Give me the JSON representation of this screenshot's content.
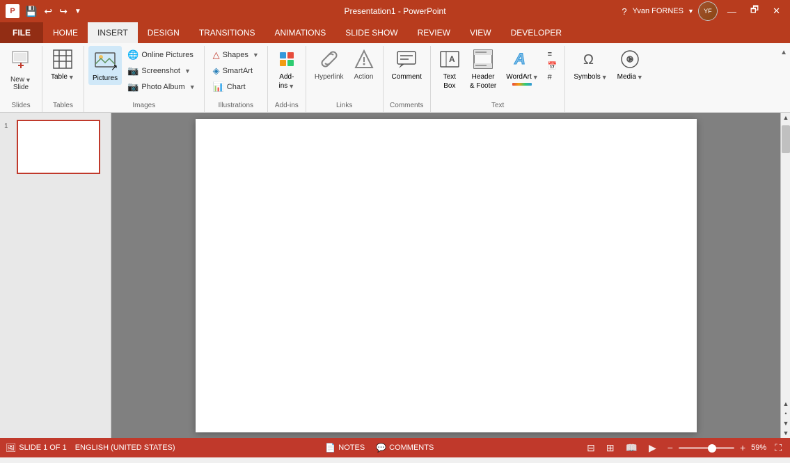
{
  "titleBar": {
    "appName": "Presentation1 - PowerPoint",
    "helpIcon": "?",
    "restoreIcon": "🗗",
    "minimizeIcon": "—",
    "maximizeIcon": "□",
    "closeIcon": "✕",
    "quickAccess": [
      "💾",
      "↩",
      "↪"
    ],
    "user": "Yvan FORNES"
  },
  "menuBar": {
    "tabs": [
      "FILE",
      "HOME",
      "INSERT",
      "DESIGN",
      "TRANSITIONS",
      "ANIMATIONS",
      "SLIDE SHOW",
      "REVIEW",
      "VIEW",
      "DEVELOPER"
    ],
    "activeTab": "INSERT"
  },
  "ribbon": {
    "groups": [
      {
        "label": "Slides",
        "buttons": [
          {
            "id": "new-slide",
            "icon": "🖼",
            "label": "New\nSlide",
            "hasArrow": true
          }
        ]
      },
      {
        "label": "Tables",
        "buttons": [
          {
            "id": "table",
            "icon": "⊞",
            "label": "Table",
            "hasArrow": true
          }
        ]
      },
      {
        "label": "Images",
        "buttons": [
          {
            "id": "pictures",
            "icon": "🖼",
            "label": "Pictures",
            "active": true
          },
          {
            "id": "online-pictures",
            "icon": "🌐",
            "label": "Online Pictures",
            "small": true
          },
          {
            "id": "screenshot",
            "icon": "📷",
            "label": "Screenshot",
            "small": true,
            "hasArrow": true
          },
          {
            "id": "photo-album",
            "icon": "📷",
            "label": "Photo Album",
            "small": true,
            "hasArrow": true
          }
        ]
      },
      {
        "label": "Illustrations",
        "buttons": [
          {
            "id": "shapes",
            "icon": "△",
            "label": "Shapes",
            "small": true,
            "hasArrow": true
          },
          {
            "id": "smartart",
            "icon": "◈",
            "label": "SmartArt",
            "small": true
          },
          {
            "id": "chart",
            "icon": "📊",
            "label": "Chart",
            "small": true
          }
        ]
      },
      {
        "label": "Add-ins",
        "buttons": [
          {
            "id": "addins",
            "icon": "🔷",
            "label": "Add-\nins",
            "hasArrow": true
          }
        ]
      },
      {
        "label": "Links",
        "buttons": [
          {
            "id": "hyperlink",
            "icon": "🔗",
            "label": "Hyperlink",
            "disabled": true
          },
          {
            "id": "action",
            "icon": "⚡",
            "label": "Action",
            "disabled": true
          }
        ]
      },
      {
        "label": "Comments",
        "buttons": [
          {
            "id": "comment",
            "icon": "💬",
            "label": "Comment"
          }
        ]
      },
      {
        "label": "Text",
        "buttons": [
          {
            "id": "text-box",
            "icon": "A",
            "label": "Text\nBox"
          },
          {
            "id": "header-footer",
            "icon": "≡",
            "label": "Header\n& Footer"
          },
          {
            "id": "wordart",
            "icon": "A",
            "label": "WordArt",
            "hasArrow": true
          },
          {
            "id": "more-text",
            "icon": "⋯",
            "label": "",
            "small": true
          }
        ]
      },
      {
        "label": "",
        "buttons": [
          {
            "id": "symbols",
            "icon": "Ω",
            "label": "Symbols",
            "hasArrow": true
          },
          {
            "id": "media",
            "icon": "🔊",
            "label": "Media",
            "hasArrow": true
          }
        ]
      }
    ]
  },
  "slidePanel": {
    "slideNumber": "1"
  },
  "statusBar": {
    "slideInfo": "SLIDE 1 OF 1",
    "language": "ENGLISH (UNITED STATES)",
    "notes": "NOTES",
    "comments": "COMMENTS",
    "zoomPercent": "59%",
    "viewIcons": [
      "normal",
      "slide-sorter",
      "reading",
      "presentation"
    ],
    "fitIcon": "⛶"
  }
}
